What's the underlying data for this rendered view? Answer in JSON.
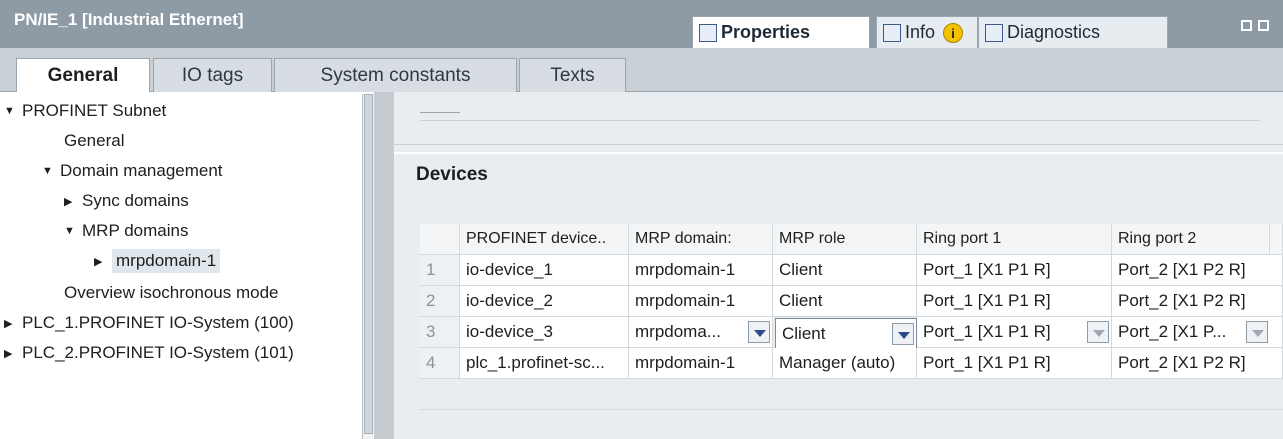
{
  "window": {
    "title": "PN/IE_1 [Industrial Ethernet]",
    "panel_tabs": [
      {
        "label": "Properties",
        "icon": "properties-icon"
      },
      {
        "label": "Info",
        "icon": "info-icon",
        "badge": "i"
      },
      {
        "label": "Diagnostics",
        "icon": "diagnostics-icon"
      }
    ]
  },
  "tabs": [
    "General",
    "IO tags",
    "System constants",
    "Texts"
  ],
  "tree": [
    {
      "label": "PROFINET Subnet",
      "expanded": true
    },
    {
      "label": "General"
    },
    {
      "label": "Domain management",
      "expanded": true
    },
    {
      "label": "Sync domains",
      "expanded": false
    },
    {
      "label": "MRP domains",
      "expanded": true
    },
    {
      "label": "mrpdomain-1",
      "expanded": false,
      "selected": true
    },
    {
      "label": "Overview isochronous mode"
    },
    {
      "label": "PLC_1.PROFINET IO-System (100)",
      "expanded": false
    },
    {
      "label": "PLC_2.PROFINET IO-System (101)",
      "expanded": false
    }
  ],
  "section": {
    "title": "Devices"
  },
  "table": {
    "headers": [
      "PROFINET device..",
      "MRP domain:",
      "MRP role",
      "Ring port 1",
      "Ring port 2"
    ],
    "rows": [
      {
        "num": "1",
        "device": "io-device_1",
        "domain": "mrpdomain-1",
        "role": "Client",
        "port1": "Port_1 [X1 P1 R]",
        "port2": "Port_2 [X1 P2 R]"
      },
      {
        "num": "2",
        "device": "io-device_2",
        "domain": "mrpdomain-1",
        "role": "Client",
        "port1": "Port_1 [X1 P1 R]",
        "port2": "Port_2 [X1 P2 R]"
      },
      {
        "num": "3",
        "device": "io-device_3",
        "domain": "mrpdoma...",
        "role": "Client",
        "port1": "Port_1 [X1 P1 R]",
        "port2": "Port_2 [X1 P..."
      },
      {
        "num": "4",
        "device": "plc_1.profinet-sc...",
        "domain": "mrpdomain-1",
        "role": "Manager (auto)",
        "port1": "Port_1 [X1 P1 R]",
        "port2": "Port_2 [X1 P2 R]"
      }
    ]
  }
}
